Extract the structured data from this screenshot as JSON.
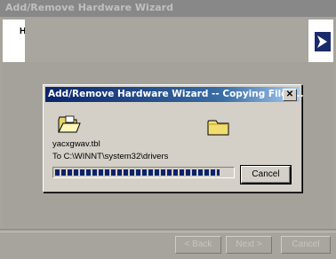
{
  "wizard": {
    "title": "Add/Remove Hardware Wizard",
    "header_text": "H",
    "buttons": {
      "back": "< Back",
      "next": "Next >",
      "cancel": "Cancel"
    }
  },
  "dialog": {
    "title": "Add/Remove Hardware Wizard -- Copying Files...",
    "close_glyph": "✕",
    "file_name": "yacxgwav.tbl",
    "destination": "To C:\\WINNT\\system32\\drivers",
    "progress_fraction": 0.93,
    "cancel_label": "Cancel"
  },
  "icons": {
    "source_folder": "open-folder-icon",
    "dest_folder": "folder-icon",
    "logo": "wizard-logo-icon"
  }
}
